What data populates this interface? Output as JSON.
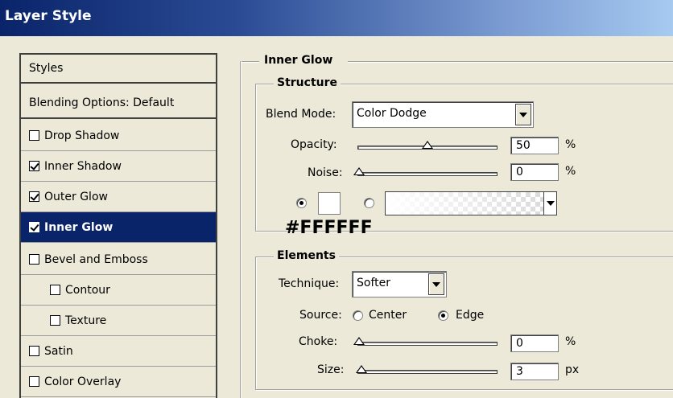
{
  "window": {
    "title": "Layer Style"
  },
  "styles_list": {
    "header": "Styles",
    "blending": "Blending Options: Default",
    "items": [
      {
        "label": "Drop Shadow",
        "checked": false
      },
      {
        "label": "Inner Shadow",
        "checked": true
      },
      {
        "label": "Outer Glow",
        "checked": true
      },
      {
        "label": "Inner Glow",
        "checked": true,
        "selected": true
      },
      {
        "label": "Bevel and Emboss",
        "checked": false
      },
      {
        "label": "Contour",
        "checked": false
      },
      {
        "label": "Texture",
        "checked": false
      },
      {
        "label": "Satin",
        "checked": false
      },
      {
        "label": "Color Overlay",
        "checked": false
      }
    ]
  },
  "panel": {
    "title": "Inner Glow",
    "structure": {
      "title": "Structure",
      "blend_mode_label": "Blend Mode:",
      "blend_mode_value": "Color Dodge",
      "opacity_label": "Opacity:",
      "opacity_value": "50",
      "opacity_unit": "%",
      "opacity_level": 0.5,
      "noise_label": "Noise:",
      "noise_value": "0",
      "noise_unit": "%",
      "noise_level": 0,
      "color_mode": "solid",
      "color_hex": "#FFFFFF"
    },
    "elements": {
      "title": "Elements",
      "technique_label": "Technique:",
      "technique_value": "Softer",
      "source_label": "Source:",
      "source_center": "Center",
      "source_edge": "Edge",
      "source_selected": "Edge",
      "choke_label": "Choke:",
      "choke_value": "0",
      "choke_unit": "%",
      "choke_level": 0,
      "size_label": "Size:",
      "size_value": "3",
      "size_unit": "px",
      "size_level": 0.01
    }
  },
  "annotation": {
    "color_label": "#FFFFFF"
  },
  "colors": {
    "selection": "#0a246a",
    "dialog_bg": "#ece9d8"
  }
}
